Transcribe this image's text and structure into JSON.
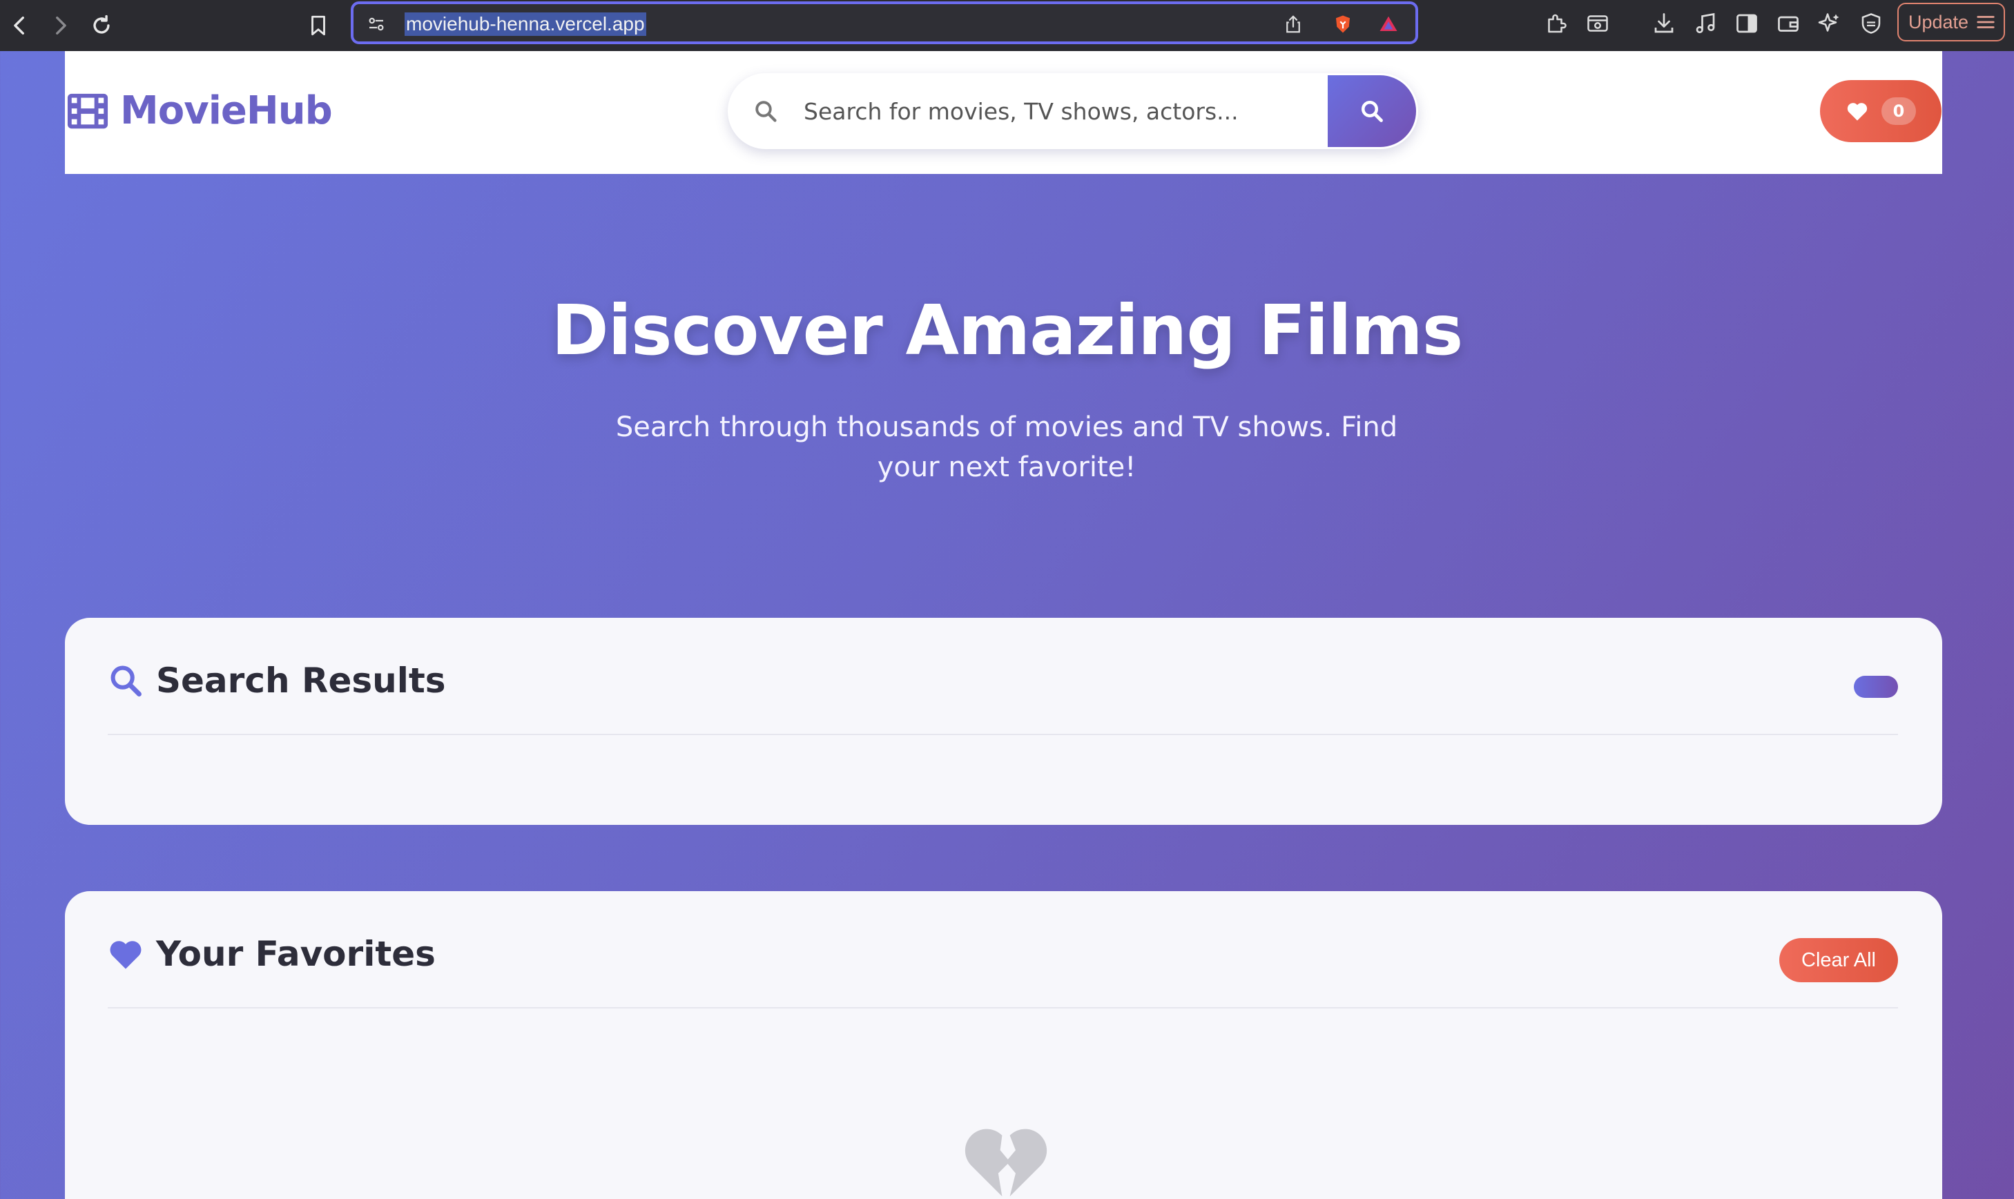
{
  "browser": {
    "url": "moviehub-henna.vercel.app",
    "update_label": "Update"
  },
  "header": {
    "logo_text": "MovieHub",
    "search_placeholder": "Search for movies, TV shows, actors...",
    "favorites_count": "0"
  },
  "hero": {
    "title": "Discover Amazing Films",
    "subtitle": "Search through thousands of movies and TV shows. Find your next favorite!"
  },
  "results_section": {
    "title": "Search Results"
  },
  "favorites_section": {
    "title": "Your Favorites",
    "clear_label": "Clear All"
  },
  "colors": {
    "brand_purple": "#6b63c6",
    "accent_coral": "#e8604c",
    "gradient_start": "#6a75dc",
    "gradient_end": "#7150a8"
  },
  "icons": [
    "back-arrow-icon",
    "forward-arrow-icon",
    "reload-icon",
    "bookmark-icon",
    "site-settings-icon",
    "share-icon",
    "brave-shield-icon",
    "brave-rewards-icon",
    "extensions-icon",
    "screenshot-icon",
    "download-icon",
    "music-icon",
    "sidebar-icon",
    "wallet-icon",
    "leo-ai-icon",
    "vpn-shield-icon",
    "menu-icon",
    "film-icon",
    "search-icon",
    "heart-icon",
    "broken-heart-icon"
  ]
}
